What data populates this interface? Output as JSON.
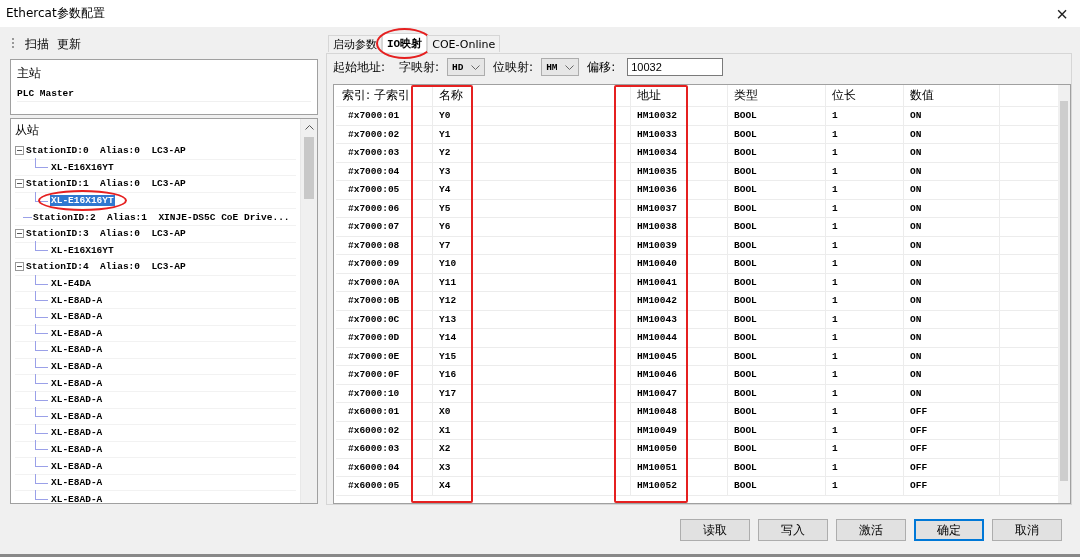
{
  "window": {
    "title": "Ethercat参数配置",
    "close": "×"
  },
  "toolbar": [
    "扫描",
    "更新"
  ],
  "master": {
    "label": "主站",
    "value": "PLC Master"
  },
  "slaves": {
    "label": "从站",
    "tree": [
      {
        "text": "StationID:0  Alias:0  LC3-AP",
        "expanded": true,
        "selected": false,
        "children": [
          {
            "text": "XL-E16X16YT",
            "selected": false,
            "circled": false
          }
        ]
      },
      {
        "text": "StationID:1  Alias:0  LC3-AP",
        "expanded": true,
        "selected": false,
        "children": [
          {
            "text": "XL-E16X16YT",
            "selected": true,
            "circled": true
          }
        ]
      },
      {
        "text": "StationID:2  Alias:1  XINJE-DS5C CoE Drive...",
        "selected": false
      },
      {
        "text": "StationID:3  Alias:0  LC3-AP",
        "expanded": true,
        "selected": false,
        "children": [
          {
            "text": "XL-E16X16YT",
            "selected": false,
            "circled": false
          }
        ]
      },
      {
        "text": "StationID:4  Alias:0  LC3-AP",
        "expanded": true,
        "selected": false,
        "children": [
          {
            "text": "XL-E4DA",
            "selected": false,
            "circled": false
          },
          {
            "text": "XL-E8AD-A",
            "selected": false,
            "circled": false
          },
          {
            "text": "XL-E8AD-A",
            "selected": false,
            "circled": false
          },
          {
            "text": "XL-E8AD-A",
            "selected": false,
            "circled": false
          },
          {
            "text": "XL-E8AD-A",
            "selected": false,
            "circled": false
          },
          {
            "text": "XL-E8AD-A",
            "selected": false,
            "circled": false
          },
          {
            "text": "XL-E8AD-A",
            "selected": false,
            "circled": false
          },
          {
            "text": "XL-E8AD-A",
            "selected": false,
            "circled": false
          },
          {
            "text": "XL-E8AD-A",
            "selected": false,
            "circled": false
          },
          {
            "text": "XL-E8AD-A",
            "selected": false,
            "circled": false
          },
          {
            "text": "XL-E8AD-A",
            "selected": false,
            "circled": false
          },
          {
            "text": "XL-E8AD-A",
            "selected": false,
            "circled": false
          },
          {
            "text": "XL-E8AD-A",
            "selected": false,
            "circled": false
          },
          {
            "text": "XL-E8AD-A",
            "selected": false,
            "circled": false
          }
        ]
      }
    ]
  },
  "tabs": [
    {
      "label": "启动参数",
      "selected": false,
      "circled": false
    },
    {
      "label": "IO映射",
      "selected": true,
      "circled": true
    },
    {
      "label": "COE-Online",
      "selected": false,
      "circled": false
    }
  ],
  "options": {
    "start_label": "起始地址:",
    "word_label": "字映射:",
    "word_value": "HD",
    "bit_label": "位映射:",
    "bit_value": "HM",
    "offset_label": "偏移:",
    "offset_value": "10032"
  },
  "table": {
    "columns": [
      {
        "label": "索引: 子索引",
        "highlighted": false
      },
      {
        "label": "名称",
        "highlighted": true
      },
      {
        "label": "地址",
        "highlighted": true
      },
      {
        "label": "类型",
        "highlighted": false
      },
      {
        "label": "位长",
        "highlighted": false
      },
      {
        "label": "数值",
        "highlighted": false
      }
    ],
    "rows": [
      [
        "#x7000:01",
        "Y0",
        "HM10032",
        "BOOL",
        "1",
        "ON"
      ],
      [
        "#x7000:02",
        "Y1",
        "HM10033",
        "BOOL",
        "1",
        "ON"
      ],
      [
        "#x7000:03",
        "Y2",
        "HM10034",
        "BOOL",
        "1",
        "ON"
      ],
      [
        "#x7000:04",
        "Y3",
        "HM10035",
        "BOOL",
        "1",
        "ON"
      ],
      [
        "#x7000:05",
        "Y4",
        "HM10036",
        "BOOL",
        "1",
        "ON"
      ],
      [
        "#x7000:06",
        "Y5",
        "HM10037",
        "BOOL",
        "1",
        "ON"
      ],
      [
        "#x7000:07",
        "Y6",
        "HM10038",
        "BOOL",
        "1",
        "ON"
      ],
      [
        "#x7000:08",
        "Y7",
        "HM10039",
        "BOOL",
        "1",
        "ON"
      ],
      [
        "#x7000:09",
        "Y10",
        "HM10040",
        "BOOL",
        "1",
        "ON"
      ],
      [
        "#x7000:0A",
        "Y11",
        "HM10041",
        "BOOL",
        "1",
        "ON"
      ],
      [
        "#x7000:0B",
        "Y12",
        "HM10042",
        "BOOL",
        "1",
        "ON"
      ],
      [
        "#x7000:0C",
        "Y13",
        "HM10043",
        "BOOL",
        "1",
        "ON"
      ],
      [
        "#x7000:0D",
        "Y14",
        "HM10044",
        "BOOL",
        "1",
        "ON"
      ],
      [
        "#x7000:0E",
        "Y15",
        "HM10045",
        "BOOL",
        "1",
        "ON"
      ],
      [
        "#x7000:0F",
        "Y16",
        "HM10046",
        "BOOL",
        "1",
        "ON"
      ],
      [
        "#x7000:10",
        "Y17",
        "HM10047",
        "BOOL",
        "1",
        "ON"
      ],
      [
        "#x6000:01",
        "X0",
        "HM10048",
        "BOOL",
        "1",
        "OFF"
      ],
      [
        "#x6000:02",
        "X1",
        "HM10049",
        "BOOL",
        "1",
        "OFF"
      ],
      [
        "#x6000:03",
        "X2",
        "HM10050",
        "BOOL",
        "1",
        "OFF"
      ],
      [
        "#x6000:04",
        "X3",
        "HM10051",
        "BOOL",
        "1",
        "OFF"
      ],
      [
        "#x6000:05",
        "X4",
        "HM10052",
        "BOOL",
        "1",
        "OFF"
      ]
    ]
  },
  "buttons": [
    {
      "label": "读取",
      "default": false
    },
    {
      "label": "写入",
      "default": false
    },
    {
      "label": "激活",
      "default": false
    },
    {
      "label": "确定",
      "default": true
    },
    {
      "label": "取消",
      "default": false
    }
  ]
}
